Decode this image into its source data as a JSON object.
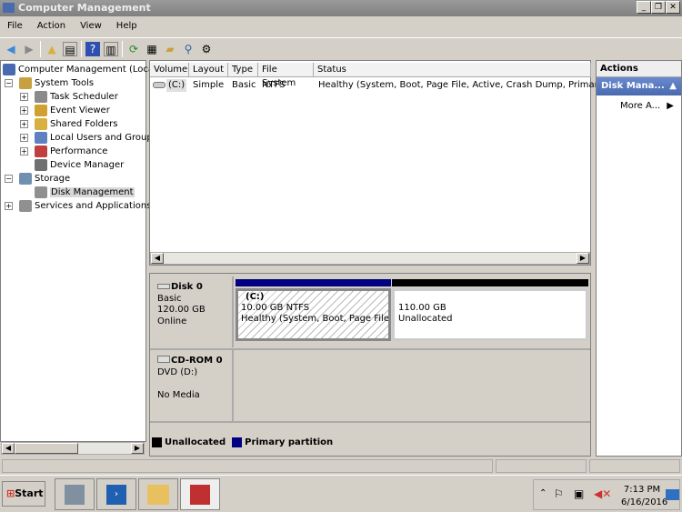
{
  "window": {
    "title": "Computer Management",
    "min": "_",
    "restore": "❐",
    "close": "✕"
  },
  "menu": [
    "File",
    "Action",
    "View",
    "Help"
  ],
  "tree": [
    {
      "label": "Computer Management (Local)",
      "level": 0,
      "color": "#4a6ab0"
    },
    {
      "label": "System Tools",
      "level": 1,
      "exp": "−",
      "color": "#c9a040"
    },
    {
      "label": "Task Scheduler",
      "level": 2,
      "exp": "+",
      "color": "#8a8a8a"
    },
    {
      "label": "Event Viewer",
      "level": 2,
      "exp": "+",
      "color": "#d0a030"
    },
    {
      "label": "Shared Folders",
      "level": 2,
      "exp": "+",
      "color": "#d8b040"
    },
    {
      "label": "Local Users and Groups",
      "level": 2,
      "exp": "+",
      "color": "#6080c0"
    },
    {
      "label": "Performance",
      "level": 2,
      "exp": "+",
      "color": "#c04040"
    },
    {
      "label": "Device Manager",
      "level": 2,
      "color": "#707070"
    },
    {
      "label": "Storage",
      "level": 1,
      "exp": "−",
      "color": "#7090b0"
    },
    {
      "label": "Disk Management",
      "level": 2,
      "color": "#909090",
      "selected": true
    },
    {
      "label": "Services and Applications",
      "level": 1,
      "exp": "+",
      "color": "#909090"
    }
  ],
  "list": {
    "columns": [
      "Volume",
      "Layout",
      "Type",
      "File System",
      "Status"
    ],
    "rows": [
      [
        "(C:)",
        "Simple",
        "Basic",
        "NTFS",
        "Healthy (System, Boot, Page File, Active, Crash Dump, Primary Pa"
      ]
    ]
  },
  "disks": [
    {
      "name": "Disk 0",
      "type": "Basic",
      "size": "120.00 GB",
      "state": "Online",
      "partitions": [
        {
          "label": "(C:)",
          "size": "10.00 GB NTFS",
          "status": "Healthy (System, Boot, Page File, A",
          "kind": "primary"
        },
        {
          "label": "",
          "size": "110.00 GB",
          "status": "Unallocated",
          "kind": "unallocated"
        }
      ]
    },
    {
      "name": "CD-ROM 0",
      "type": "DVD (D:)",
      "state": "No Media"
    }
  ],
  "legend": [
    {
      "label": "Unallocated",
      "color": "#000000"
    },
    {
      "label": "Primary partition",
      "color": "#000080"
    }
  ],
  "actions": {
    "header": "Actions",
    "section": "Disk Mana...",
    "more": "More A..."
  },
  "taskbar": {
    "start": "Start",
    "time": "7:13 PM",
    "date": "6/16/2016"
  }
}
